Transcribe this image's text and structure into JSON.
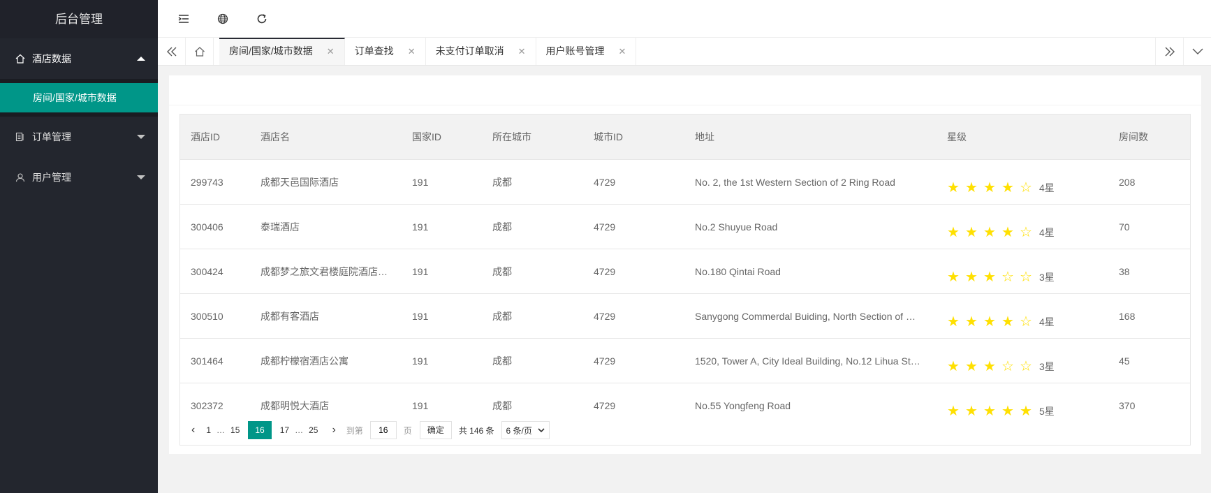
{
  "sidebar": {
    "title": "后台管理",
    "menu": [
      {
        "label": "酒店数据",
        "icon": "home-icon",
        "expanded": true
      },
      {
        "label": "订单管理",
        "icon": "order-icon",
        "expanded": false
      },
      {
        "label": "用户管理",
        "icon": "user-icon",
        "expanded": false
      }
    ],
    "submenu": [
      {
        "label": "房间/国家/城市数据"
      }
    ]
  },
  "tabs": [
    {
      "label": "房间/国家/城市数据",
      "active": true
    },
    {
      "label": "订单查找"
    },
    {
      "label": "未支付订单取消"
    },
    {
      "label": "用户账号管理"
    }
  ],
  "table": {
    "headers": [
      "酒店ID",
      "酒店名",
      "国家ID",
      "所在城市",
      "城市ID",
      "地址",
      "星级",
      "房间数"
    ],
    "rows": [
      {
        "id": "299743",
        "name": "成都天邑国际酒店",
        "country": "191",
        "city": "成都",
        "city_id": "4729",
        "address": "No. 2, the 1st Western Section of 2 Ring Road",
        "stars": 4,
        "star_label": "4星",
        "rooms": "208"
      },
      {
        "id": "300406",
        "name": "泰瑞酒店",
        "country": "191",
        "city": "成都",
        "city_id": "4729",
        "address": "No.2 Shuyue Road",
        "stars": 4,
        "star_label": "4星",
        "rooms": "70"
      },
      {
        "id": "300424",
        "name": "成都梦之旅文君楼庭院酒店…",
        "country": "191",
        "city": "成都",
        "city_id": "4729",
        "address": "No.180 Qintai Road",
        "stars": 3,
        "star_label": "3星",
        "rooms": "38"
      },
      {
        "id": "300510",
        "name": "成都有客酒店",
        "country": "191",
        "city": "成都",
        "city_id": "4729",
        "address": "Sanygong Commerdal Buiding, North Section of …",
        "stars": 4,
        "star_label": "4星",
        "rooms": "168"
      },
      {
        "id": "301464",
        "name": "成都柠檬宿酒店公寓",
        "country": "191",
        "city": "成都",
        "city_id": "4729",
        "address": "1520, Tower A, City Ideal Building, No.12 Lihua St…",
        "stars": 3,
        "star_label": "3星",
        "rooms": "45"
      },
      {
        "id": "302372",
        "name": "成都明悦大酒店",
        "country": "191",
        "city": "成都",
        "city_id": "4729",
        "address": "No.55 Yongfeng Road",
        "stars": 5,
        "star_label": "5星",
        "rooms": "370"
      }
    ]
  },
  "pager": {
    "pages": [
      "1",
      "…",
      "15",
      "16",
      "17",
      "…",
      "25"
    ],
    "current": "16",
    "goto_label": "到第",
    "goto_value": "16",
    "page_suffix": "页",
    "confirm": "确定",
    "total": "共 146 条",
    "page_size": "6 条/页"
  },
  "colors": {
    "accent": "#009688",
    "sidebar": "#23262e",
    "star": "#ffe000"
  }
}
